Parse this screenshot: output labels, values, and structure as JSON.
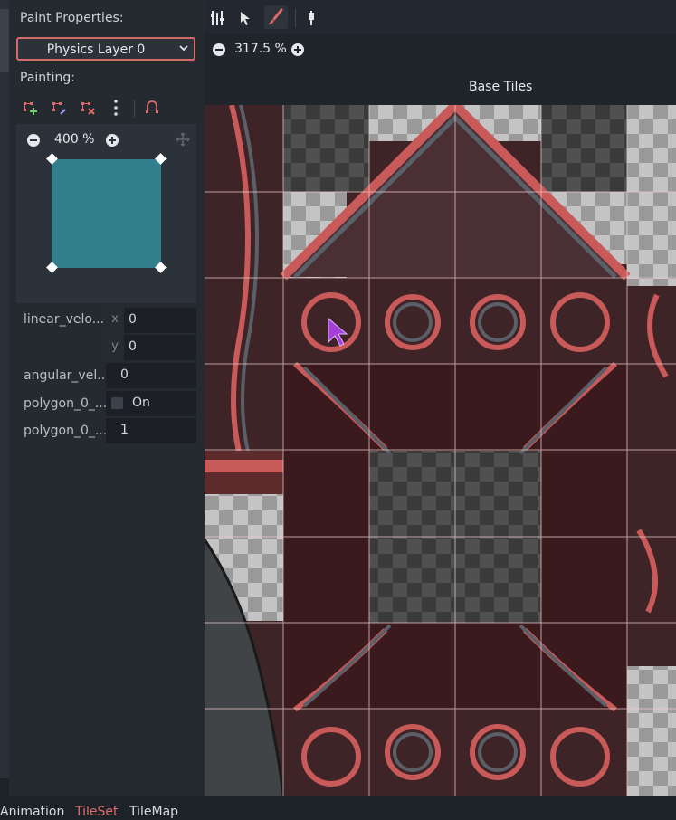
{
  "left_panel": {
    "paint_properties_label": "Paint Properties:",
    "layer_dropdown": "Physics Layer 0",
    "painting_label": "Painting:",
    "preview_zoom": "400 %",
    "properties": [
      {
        "name": "linear_velo...",
        "x": "0",
        "y": "0"
      },
      {
        "name": "angular_vel...",
        "value": "0"
      },
      {
        "name": "polygon_0_...",
        "checkbox_label": "On"
      },
      {
        "name": "polygon_0_...",
        "value": "1"
      }
    ],
    "axis_x": "x",
    "axis_y": "y"
  },
  "editor": {
    "zoom": "317.5 %",
    "atlas_title": "Base Tiles"
  },
  "bottom_tabs": {
    "animation": "Animation",
    "tileset": "TileSet",
    "tilemap": "TileMap"
  },
  "colors": {
    "accent": "#d36a6a",
    "collision_color": "#317f8d",
    "panel_bg": "#252a31"
  }
}
